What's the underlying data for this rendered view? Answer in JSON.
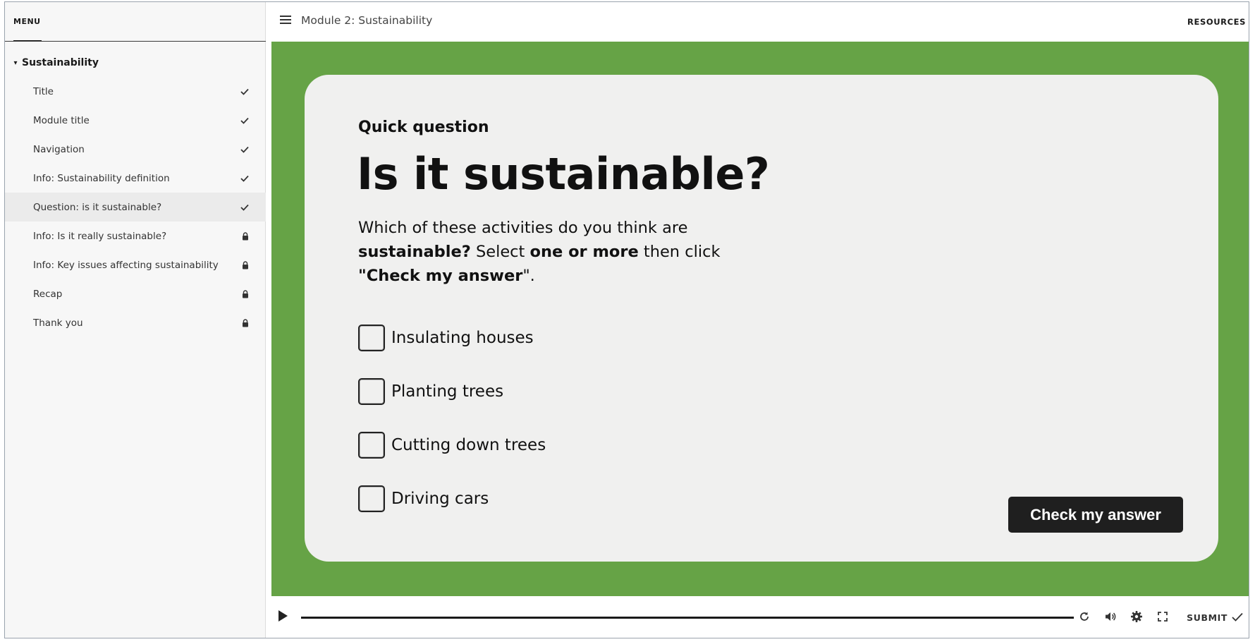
{
  "sidebar": {
    "menu_label": "MENU",
    "section_title": "Sustainability",
    "items": [
      {
        "label": "Title",
        "status": "complete"
      },
      {
        "label": "Module title",
        "status": "complete"
      },
      {
        "label": "Navigation",
        "status": "complete"
      },
      {
        "label": "Info: Sustainability definition",
        "status": "complete"
      },
      {
        "label": "Question: is it sustainable?",
        "status": "complete"
      },
      {
        "label": "Info: Is it really sustainable?",
        "status": "locked"
      },
      {
        "label": "Info: Key issues affecting sustainability",
        "status": "locked"
      },
      {
        "label": "Recap",
        "status": "locked"
      },
      {
        "label": "Thank you",
        "status": "locked"
      }
    ]
  },
  "header": {
    "module_title": "Module 2: Sustainability",
    "resources_label": "RESOURCES"
  },
  "slide": {
    "eyebrow": "Quick question",
    "heading": "Is it sustainable?",
    "prompt": {
      "p1": "Which of these activities do you think are ",
      "b1": "sustainable?",
      "p2": " Select ",
      "b2": "one or more",
      "p3": " then click ",
      "b3": "\"Check my answer",
      "p4": "\"."
    },
    "options": [
      {
        "label": "Insulating houses",
        "checked": false
      },
      {
        "label": "Planting trees",
        "checked": false
      },
      {
        "label": "Cutting down trees",
        "checked": false
      },
      {
        "label": "Driving cars",
        "checked": false
      }
    ],
    "check_button": "Check my answer",
    "background_color": "#66a346"
  },
  "player": {
    "submit_label": "SUBMIT",
    "icons": [
      "play-icon",
      "replay-icon",
      "volume-icon",
      "settings-icon",
      "fullscreen-icon",
      "checkmark-icon"
    ]
  }
}
